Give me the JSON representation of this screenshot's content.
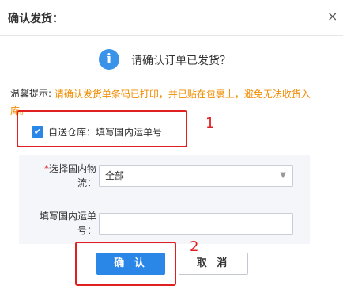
{
  "dialog": {
    "title": "确认发货：",
    "close_glyph": "×",
    "info_glyph": "i",
    "confirm_message": "请确认订单已发货？",
    "tip_label": "温馨提示:",
    "tip_text": "请确认发货单条码已打印，并已贴在包裹上，避免无法收货入库。",
    "checkbox": {
      "checked": true,
      "label": "自送仓库：填写国内运单号"
    },
    "form": {
      "logistics_label_required": "*",
      "logistics_label": "选择国内物流：",
      "logistics_selected": "全部",
      "tracking_label": "填写国内运单号："
    },
    "buttons": {
      "ok_label": "确 认",
      "cancel_label": "取 消"
    },
    "annotations": {
      "marker_1": "1",
      "marker_2": "2"
    }
  },
  "colors": {
    "accent": "#2a87e8",
    "warning_text": "#f08c00",
    "annotation_red": "#e02020"
  }
}
